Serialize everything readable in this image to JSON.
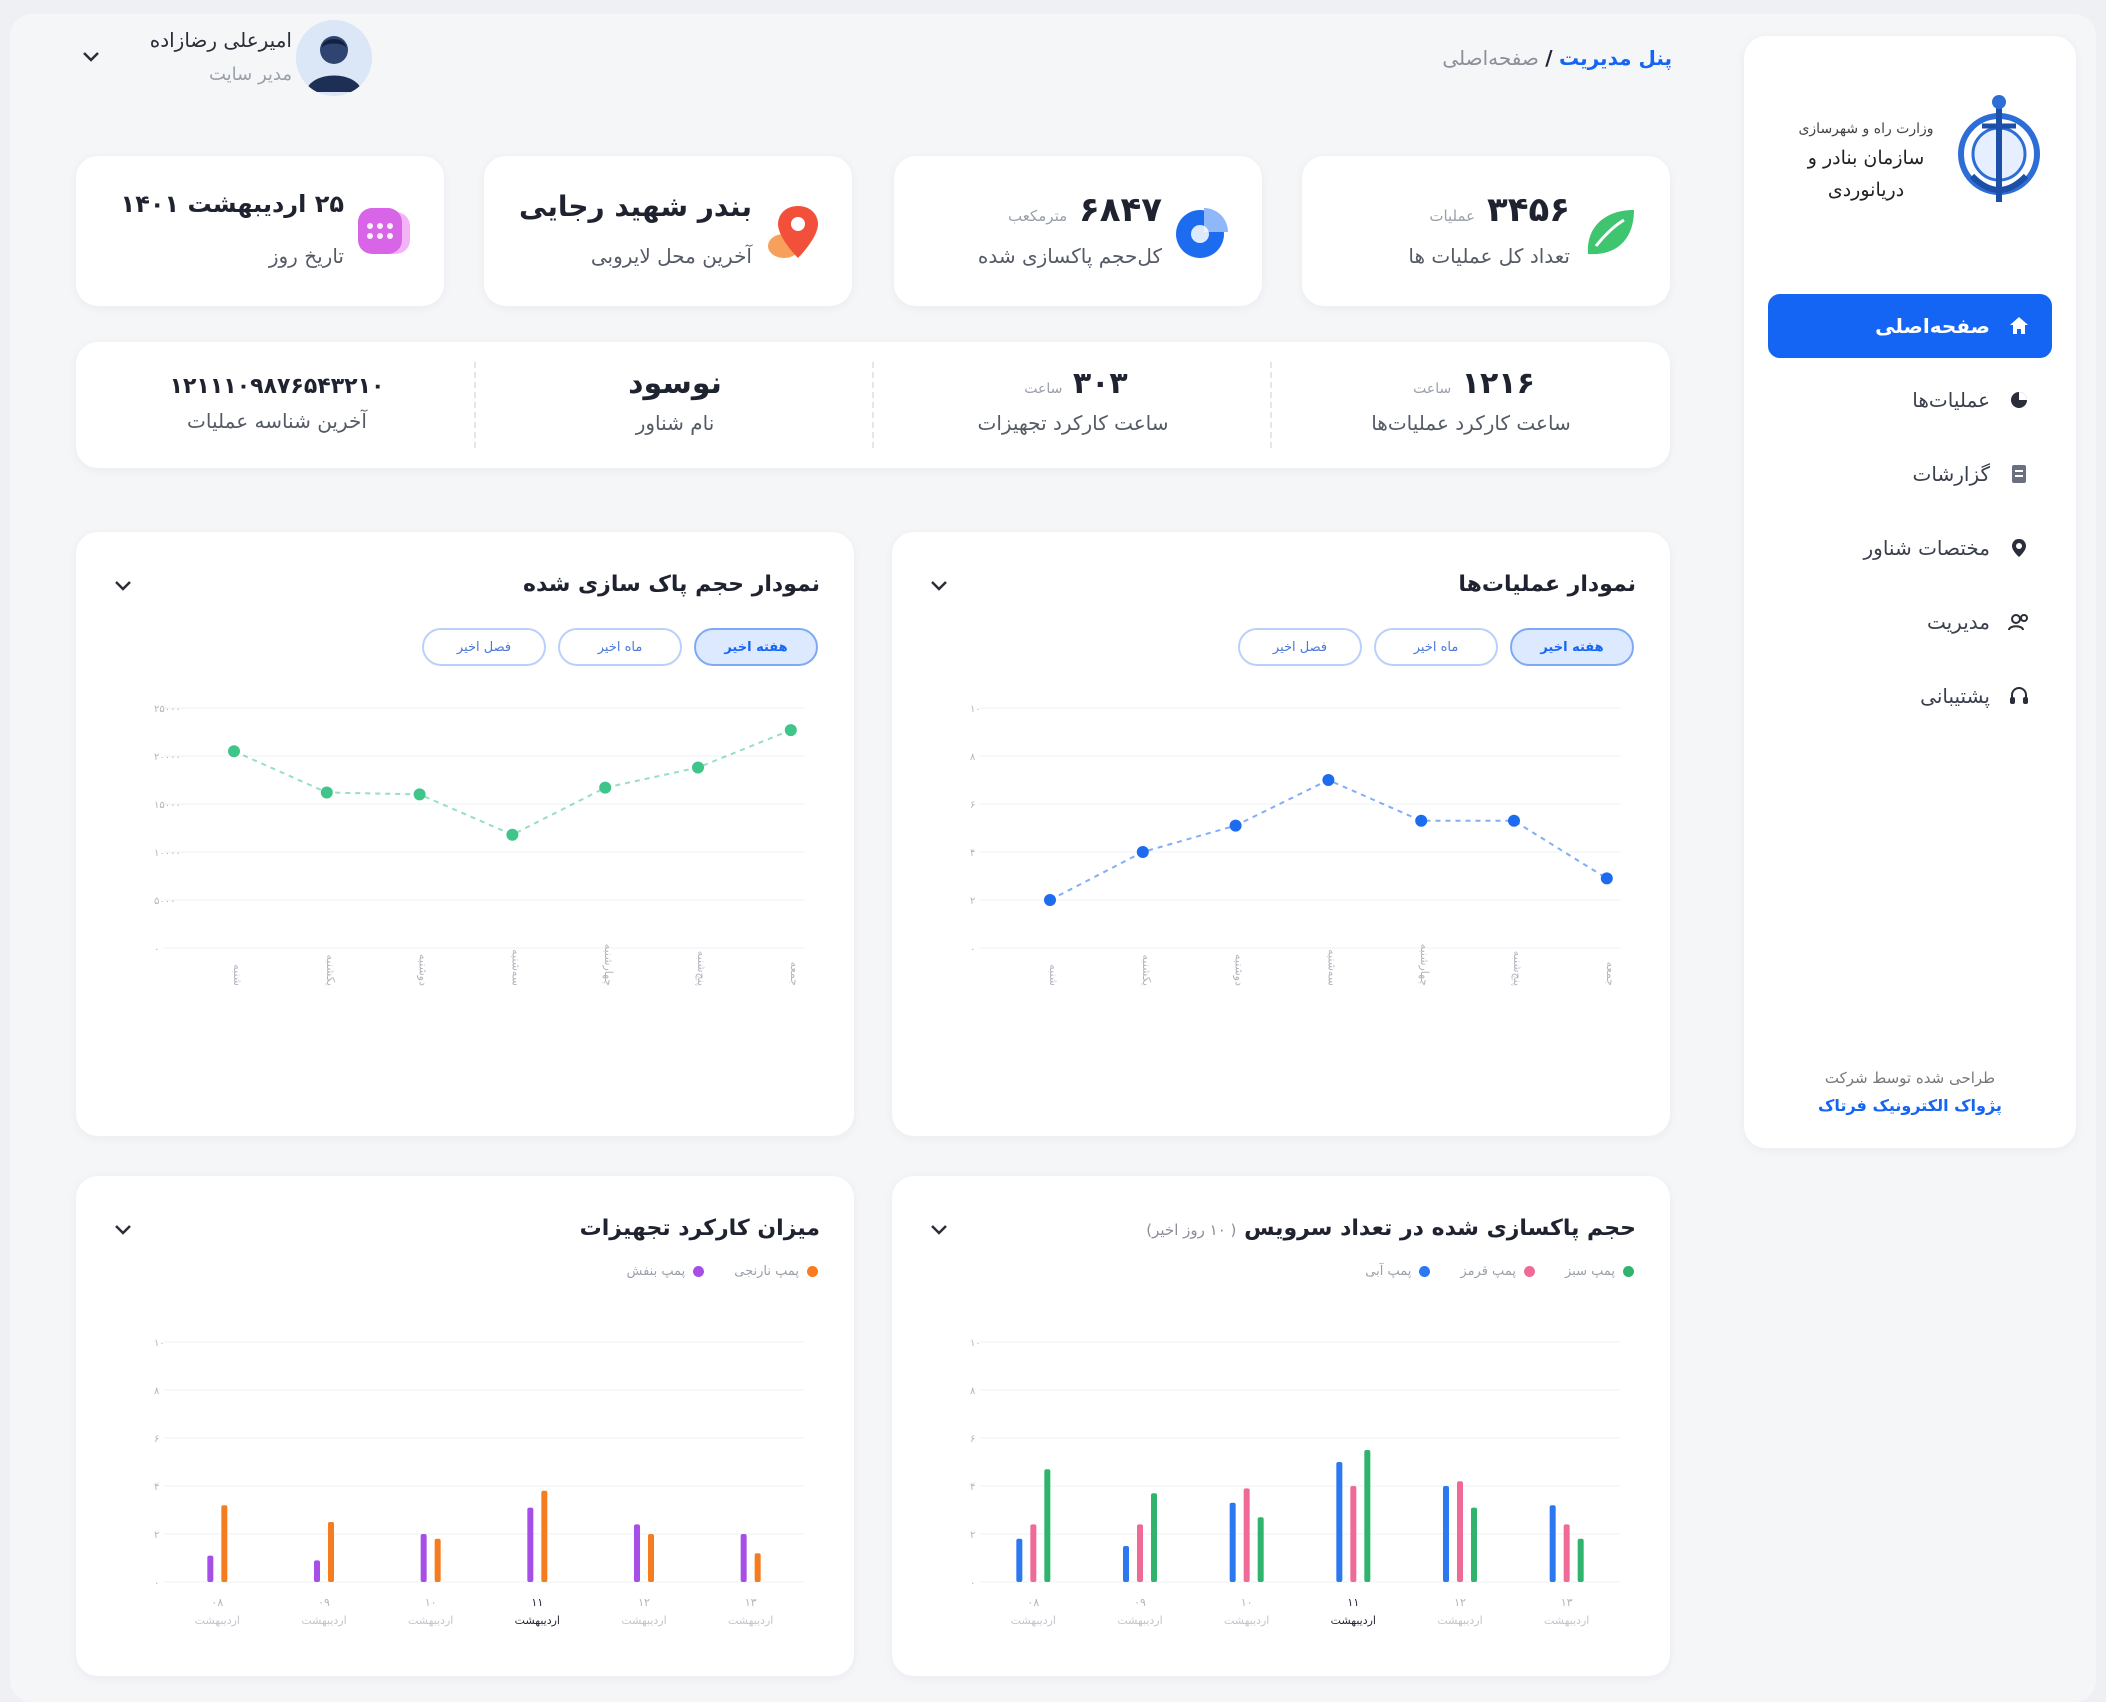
{
  "header": {
    "breadcrumb_root": "پنل مدیریت",
    "breadcrumb_sep": "/",
    "breadcrumb_current": "صفحه‌اصلی",
    "user_name": "امیرعلی رضازاده",
    "user_role": "مدیر سایت"
  },
  "sidebar": {
    "logo_line1": "وزارت راه و شهرسازی",
    "logo_line2": "سازمان بنادر و دریانوردی",
    "items": [
      {
        "label": "صفحه‌اصلی",
        "icon": "home-icon",
        "active": true
      },
      {
        "label": "عملیات‌ها",
        "icon": "pie-icon",
        "active": false
      },
      {
        "label": "گزارشات",
        "icon": "document-icon",
        "active": false
      },
      {
        "label": "مختصات شناور",
        "icon": "pin-icon",
        "active": false
      },
      {
        "label": "مدیریت",
        "icon": "users-icon",
        "active": false
      },
      {
        "label": "پشتیبانی",
        "icon": "headset-icon",
        "active": false
      }
    ],
    "credit_line1": "طراحی شده توسط شرکت",
    "credit_line2": "پژواک الکترونیک فرتاک"
  },
  "stats": [
    {
      "value": "۳۴۵۶",
      "unit": "عملیات",
      "label": "تعداد کل عملیات ها",
      "icon": "leaf-icon",
      "color": "#3fc46f"
    },
    {
      "value": "۶۸۴۷",
      "unit": "مترمکعب",
      "label": "کل‌حجم پاکسازی شده",
      "icon": "pie-chart-icon",
      "color": "#1d6cf0"
    },
    {
      "value": "بندر شهید رجایی",
      "unit": "",
      "label": "آخرین محل لایروبی",
      "icon": "map-pin-icon",
      "color": "#f2672e"
    },
    {
      "value": "۲۵ اردیبهشت ۱۴۰۱",
      "unit": "",
      "label": "تاریخ روز",
      "icon": "calendar-icon",
      "color": "#d864e8"
    }
  ],
  "info": [
    {
      "value": "۱۲۱۶",
      "unit": "ساعت",
      "label": "ساعت کارکرد عملیات‌ها"
    },
    {
      "value": "۳۰۳",
      "unit": "ساعت",
      "label": "ساعت کارکرد تجهیزات"
    },
    {
      "value": "نوسود",
      "unit": "",
      "label": "نام شناور"
    },
    {
      "value": "۱۲۱۱۱۰۹۸۷۶۵۴۳۲۱۰",
      "unit": "",
      "label": "آخرین شناسه عملیات"
    }
  ],
  "charts": {
    "operations": {
      "title": "نمودار عملیات‌ها",
      "pills": [
        "هفته اخیر",
        "ماه اخیر",
        "فصل اخیر"
      ],
      "active_pill": 0
    },
    "volume": {
      "title": "نمودار حجم پاک سازی شده",
      "pills": [
        "هفته اخیر",
        "ماه اخیر",
        "فصل اخیر"
      ],
      "active_pill": 0
    },
    "service": {
      "title": "حجم پاکسازی شده در تعداد سرویس",
      "subtitle": "( ۱۰ روز اخیر)",
      "legend": [
        {
          "label": "پمپ سبز",
          "color": "#2fb36d"
        },
        {
          "label": "پمپ قرمز",
          "color": "#f06a97"
        },
        {
          "label": "پمپ آبی",
          "color": "#2b78f0"
        }
      ]
    },
    "equipment": {
      "title": "میزان کارکرد تجهیزات",
      "legend": [
        {
          "label": "پمپ نارنجی",
          "color": "#f57c1f"
        },
        {
          "label": "پمپ بنفش",
          "color": "#a64fe8"
        }
      ]
    }
  },
  "chart_data": [
    {
      "type": "line",
      "title": "نمودار عملیات‌ها",
      "categories": [
        "شنبه",
        "یکشنبه",
        "دوشنبه",
        "سه‌شنبه",
        "چهارشنبه",
        "پنج‌شنبه",
        "جمعه"
      ],
      "values": [
        2,
        4,
        5.1,
        7,
        5.3,
        5.3,
        2.9
      ],
      "ylim": [
        0,
        10
      ],
      "yticks": [
        "۰",
        "۲",
        "۴",
        "۶",
        "۸",
        "۱۰"
      ],
      "color": "#1d6cf0"
    },
    {
      "type": "line",
      "title": "نمودار حجم پاک سازی شده",
      "categories": [
        "شنبه",
        "یکشنبه",
        "دوشنبه",
        "سه‌شنبه",
        "چهارشنبه",
        "پنج‌شنبه",
        "جمعه"
      ],
      "values": [
        20500,
        16200,
        16000,
        11800,
        16700,
        18800,
        22700
      ],
      "ylim": [
        0,
        25000
      ],
      "yticks": [
        "۰",
        "۵۰۰۰",
        "۱۰۰۰۰",
        "۱۵۰۰۰",
        "۲۰۰۰۰",
        "۲۵۰۰۰"
      ],
      "color": "#3fc48a"
    },
    {
      "type": "bar",
      "title": "حجم پاکسازی شده در تعداد سرویس",
      "categories": [
        "۰۸ اردیبهشت",
        "۰۹ اردیبهشت",
        "۱۰ اردیبهشت",
        "۱۱ اردیبهشت",
        "۱۲ اردیبهشت",
        "۱۳ اردیبهشت"
      ],
      "active_category": 3,
      "series": [
        {
          "name": "پمپ آبی",
          "color": "#2b78f0",
          "values": [
            1.8,
            1.5,
            3.3,
            5,
            4,
            3.2
          ]
        },
        {
          "name": "پمپ قرمز",
          "color": "#f06a97",
          "values": [
            2.4,
            2.4,
            3.9,
            4,
            4.2,
            2.4
          ]
        },
        {
          "name": "پمپ سبز",
          "color": "#2fb36d",
          "values": [
            4.7,
            3.7,
            2.7,
            5.5,
            3.1,
            1.8
          ]
        }
      ],
      "ylim": [
        0,
        10
      ],
      "yticks": [
        "۰",
        "۲",
        "۴",
        "۶",
        "۸",
        "۱۰"
      ]
    },
    {
      "type": "bar",
      "title": "میزان کارکرد تجهیزات",
      "categories": [
        "۰۸ اردیبهشت",
        "۰۹ اردیبهشت",
        "۱۰ اردیبهشت",
        "۱۱ اردیبهشت",
        "۱۲ اردیبهشت",
        "۱۳ اردیبهشت"
      ],
      "active_category": 3,
      "series": [
        {
          "name": "پمپ بنفش",
          "color": "#a64fe8",
          "values": [
            1.1,
            0.9,
            2,
            3.1,
            2.4,
            2
          ]
        },
        {
          "name": "پمپ نارنجی",
          "color": "#f57c1f",
          "values": [
            3.2,
            2.5,
            1.8,
            3.8,
            2,
            1.2
          ]
        }
      ],
      "ylim": [
        0,
        10
      ],
      "yticks": [
        "۰",
        "۲",
        "۴",
        "۶",
        "۸",
        "۱۰"
      ]
    }
  ]
}
